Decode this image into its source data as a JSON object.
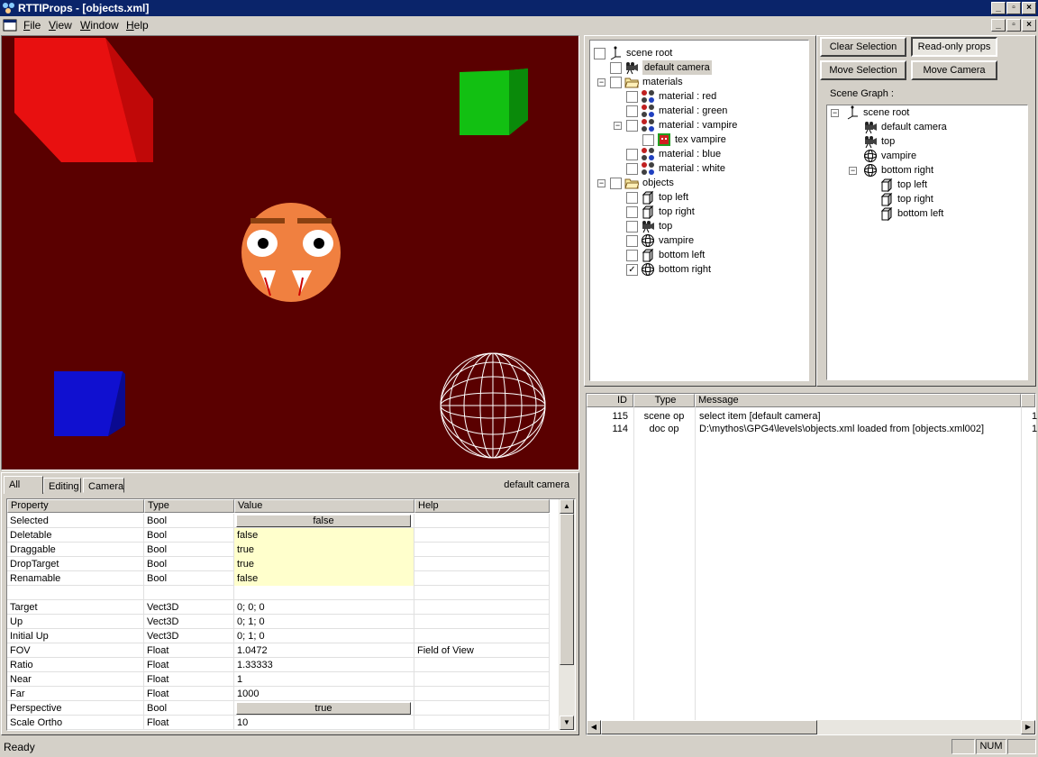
{
  "window": {
    "title": "RTTIProps - [objects.xml]"
  },
  "menu": [
    {
      "label": "File",
      "u": "F",
      "rest": "ile"
    },
    {
      "label": "View",
      "u": "V",
      "rest": "iew"
    },
    {
      "label": "Window",
      "u": "W",
      "rest": "indow"
    },
    {
      "label": "Help",
      "u": "H",
      "rest": "elp"
    }
  ],
  "colors": {
    "titlebar": "#0a246a",
    "viewport_bg": "#5a0000",
    "red_cube": "#e81010",
    "green_cube": "#10c010",
    "blue_cube": "#1010d0",
    "face": "#f08040"
  },
  "left_tree": {
    "nodes": [
      {
        "label": "scene root",
        "icon": "scene-root-icon",
        "checked": false
      },
      {
        "label": "default camera",
        "icon": "camera-icon",
        "checked": false,
        "selected": true
      },
      {
        "label": "materials",
        "icon": "folder-icon",
        "checked": false
      },
      {
        "label": "material : red",
        "icon": "material-icon",
        "checked": false
      },
      {
        "label": "material : green",
        "icon": "material-icon",
        "checked": false
      },
      {
        "label": "material : vampire",
        "icon": "material-icon",
        "checked": false
      },
      {
        "label": "tex vampire",
        "icon": "texture-icon",
        "checked": false
      },
      {
        "label": "material : blue",
        "icon": "material-icon",
        "checked": false
      },
      {
        "label": "material : white",
        "icon": "material-icon",
        "checked": false
      },
      {
        "label": "objects",
        "icon": "folder-icon",
        "checked": false
      },
      {
        "label": "top left",
        "icon": "box-icon",
        "checked": false
      },
      {
        "label": "top right",
        "icon": "box-icon",
        "checked": false
      },
      {
        "label": "top",
        "icon": "camera-icon",
        "checked": false
      },
      {
        "label": "vampire",
        "icon": "sphere-icon",
        "checked": false
      },
      {
        "label": "bottom left",
        "icon": "box-icon",
        "checked": false
      },
      {
        "label": "bottom right",
        "icon": "sphere-icon",
        "checked": true
      }
    ]
  },
  "buttons": {
    "clear_selection": "Clear Selection",
    "readonly_props": "Read-only props",
    "move_selection": "Move Selection",
    "move_camera": "Move Camera"
  },
  "scene_graph": {
    "label": "Scene Graph :",
    "nodes": [
      {
        "label": "scene root",
        "icon": "scene-root-icon"
      },
      {
        "label": "default camera",
        "icon": "camera-icon"
      },
      {
        "label": "top",
        "icon": "camera-icon"
      },
      {
        "label": "vampire",
        "icon": "sphere-icon"
      },
      {
        "label": "bottom right",
        "icon": "sphere-icon"
      },
      {
        "label": "top left",
        "icon": "box-icon"
      },
      {
        "label": "top right",
        "icon": "box-icon"
      },
      {
        "label": "bottom left",
        "icon": "box-icon"
      }
    ]
  },
  "log": {
    "headers": [
      "ID",
      "Type",
      "Message"
    ],
    "rows": [
      {
        "id": "115",
        "type": "scene op",
        "message": "select item [default camera]",
        "extra": "1"
      },
      {
        "id": "114",
        "type": "doc op",
        "message": "D:\\mythos\\GPG4\\levels\\objects.xml loaded from [objects.xml002]",
        "extra": "1"
      }
    ]
  },
  "props": {
    "tabs": [
      "All",
      "Editing",
      "Camera"
    ],
    "current_object": "default camera",
    "headers": [
      "Property",
      "Type",
      "Value",
      "Help"
    ],
    "rows": [
      {
        "property": "Selected",
        "type": "Bool",
        "value": "false",
        "help": "",
        "kind": "button"
      },
      {
        "property": "Deletable",
        "type": "Bool",
        "value": "false",
        "help": "",
        "kind": "yellow"
      },
      {
        "property": "Draggable",
        "type": "Bool",
        "value": "true",
        "help": "",
        "kind": "yellow"
      },
      {
        "property": "DropTarget",
        "type": "Bool",
        "value": "true",
        "help": "",
        "kind": "yellow"
      },
      {
        "property": "Renamable",
        "type": "Bool",
        "value": "false",
        "help": "",
        "kind": "yellow"
      },
      {
        "property": "",
        "type": "",
        "value": "",
        "help": "",
        "kind": "blank"
      },
      {
        "property": "Target",
        "type": "Vect3D",
        "value": "0; 0; 0",
        "help": "",
        "kind": "plain"
      },
      {
        "property": "Up",
        "type": "Vect3D",
        "value": "0; 1; 0",
        "help": "",
        "kind": "plain"
      },
      {
        "property": "Initial Up",
        "type": "Vect3D",
        "value": "0; 1; 0",
        "help": "",
        "kind": "plain"
      },
      {
        "property": "FOV",
        "type": "Float",
        "value": "1.0472",
        "help": "Field of View",
        "kind": "plain"
      },
      {
        "property": "Ratio",
        "type": "Float",
        "value": "1.33333",
        "help": "",
        "kind": "plain"
      },
      {
        "property": "Near",
        "type": "Float",
        "value": "1",
        "help": "",
        "kind": "plain"
      },
      {
        "property": "Far",
        "type": "Float",
        "value": "1000",
        "help": "",
        "kind": "plain"
      },
      {
        "property": "Perspective",
        "type": "Bool",
        "value": "true",
        "help": "",
        "kind": "button"
      },
      {
        "property": "Scale Ortho",
        "type": "Float",
        "value": "10",
        "help": "",
        "kind": "plain"
      }
    ]
  },
  "status": {
    "text": "Ready",
    "num": "NUM"
  }
}
